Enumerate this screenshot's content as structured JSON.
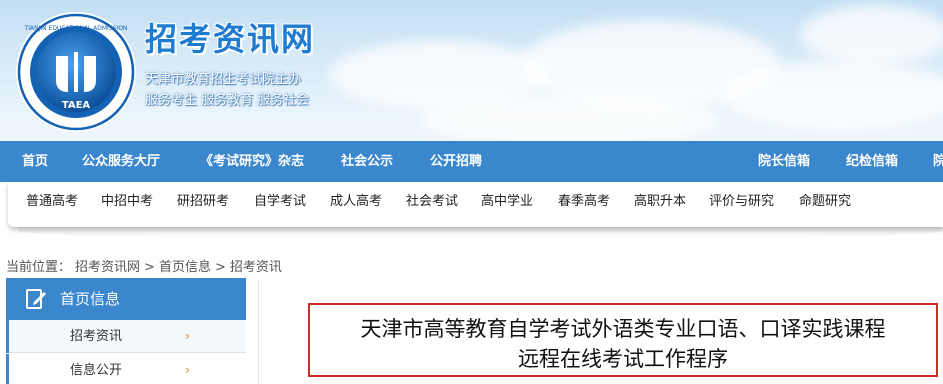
{
  "banner": {
    "site_name": "招考资讯网",
    "subtitle1": "天津市教育招生考试院主办",
    "subtitle2": "服务考生 服务教育 服务社会",
    "logo_text": "TAEA"
  },
  "main_nav": {
    "items": [
      "首页",
      "公众服务大厅",
      "《考试研究》杂志",
      "社会公示",
      "公开招聘"
    ],
    "right_items": [
      "院长信箱",
      "纪检信箱",
      "院"
    ]
  },
  "sub_nav": {
    "items": [
      "普通高考",
      "中招中考",
      "研招研考",
      "自学考试",
      "成人高考",
      "社会考试",
      "高中学业",
      "春季高考",
      "高职升本",
      "评价与研究",
      "命题研究"
    ]
  },
  "breadcrumb": {
    "prefix": "当前位置：",
    "items": [
      "招考资讯网",
      "首页信息",
      "招考资讯"
    ],
    "separator": ">"
  },
  "sidebar": {
    "heading": "首页信息",
    "items": [
      {
        "label": "招考资讯",
        "arrow": "›"
      },
      {
        "label": "信息公开",
        "arrow": "›"
      }
    ]
  },
  "article": {
    "title_line1": "天津市高等教育自学考试外语类专业口语、口译实践课程",
    "title_line2": "远程在线考试工作程序"
  },
  "colors": {
    "nav_blue": "#3a87ce",
    "title_border": "#d32a2a",
    "arrow": "#e8a23a"
  }
}
